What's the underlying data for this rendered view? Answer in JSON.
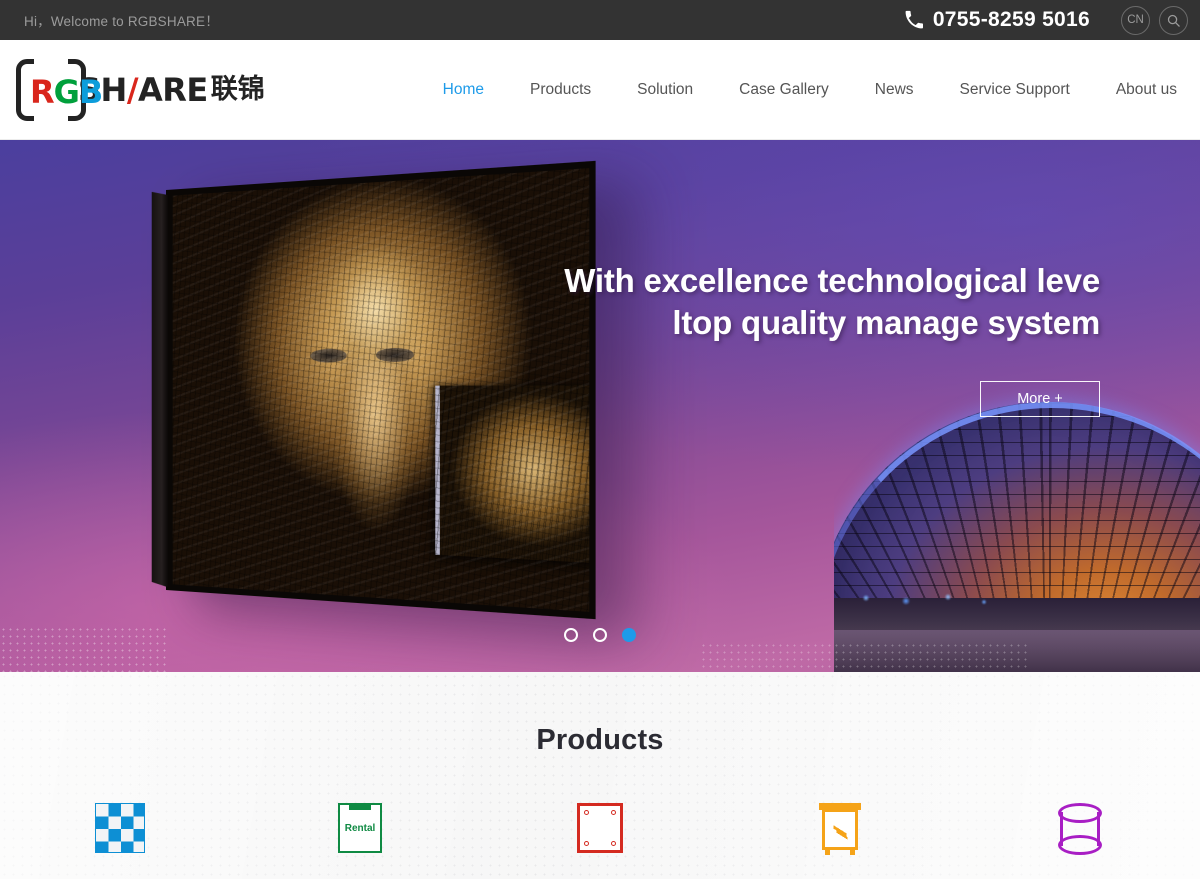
{
  "topbar": {
    "welcome": "Hi，Welcome to RGBSHARE！",
    "phone_icon": "phone-icon",
    "phone": "0755-8259 5016",
    "language_label": "CN",
    "search_icon": "search-icon"
  },
  "header": {
    "logo": {
      "r": "R",
      "g": "G",
      "b": "B",
      "share_left": "SH",
      "share_slash": "/",
      "share_right": "ARE",
      "chinese": "联锦"
    },
    "nav": [
      {
        "label": "Home",
        "active": true
      },
      {
        "label": "Products",
        "active": false
      },
      {
        "label": "Solution",
        "active": false
      },
      {
        "label": "Case Gallery",
        "active": false
      },
      {
        "label": "News",
        "active": false
      },
      {
        "label": "Service Support",
        "active": false
      },
      {
        "label": "About us",
        "active": false
      }
    ]
  },
  "hero": {
    "title_line1": "With excellence technological leve",
    "title_line2": "ltop quality manage system",
    "more_label": "More +",
    "slides": [
      {
        "index": 1,
        "active": false
      },
      {
        "index": 2,
        "active": false
      },
      {
        "index": 3,
        "active": true
      }
    ]
  },
  "products": {
    "title": "Products",
    "items": [
      {
        "icon": "checkerboard-panel-icon",
        "label": ""
      },
      {
        "icon": "rental-screen-icon",
        "label": "Rental"
      },
      {
        "icon": "fixed-panel-icon",
        "label": ""
      },
      {
        "icon": "power-cabinet-icon",
        "label": ""
      },
      {
        "icon": "cylinder-display-icon",
        "label": ""
      }
    ]
  },
  "colors": {
    "accent_blue": "#1e9be9",
    "topbar_bg": "#333333",
    "logo_red": "#d9261c",
    "logo_green": "#00a03c",
    "logo_blue": "#0d9ddb",
    "hero_gradient_top": "#4b3f9e",
    "hero_gradient_bottom": "#bf6aa6",
    "products_bg": "#f4f4f4",
    "icon_blue": "#0d8fd4",
    "icon_green": "#0f8a43",
    "icon_red": "#d42a20",
    "icon_orange": "#f5a318",
    "icon_purple": "#a81ec4"
  }
}
